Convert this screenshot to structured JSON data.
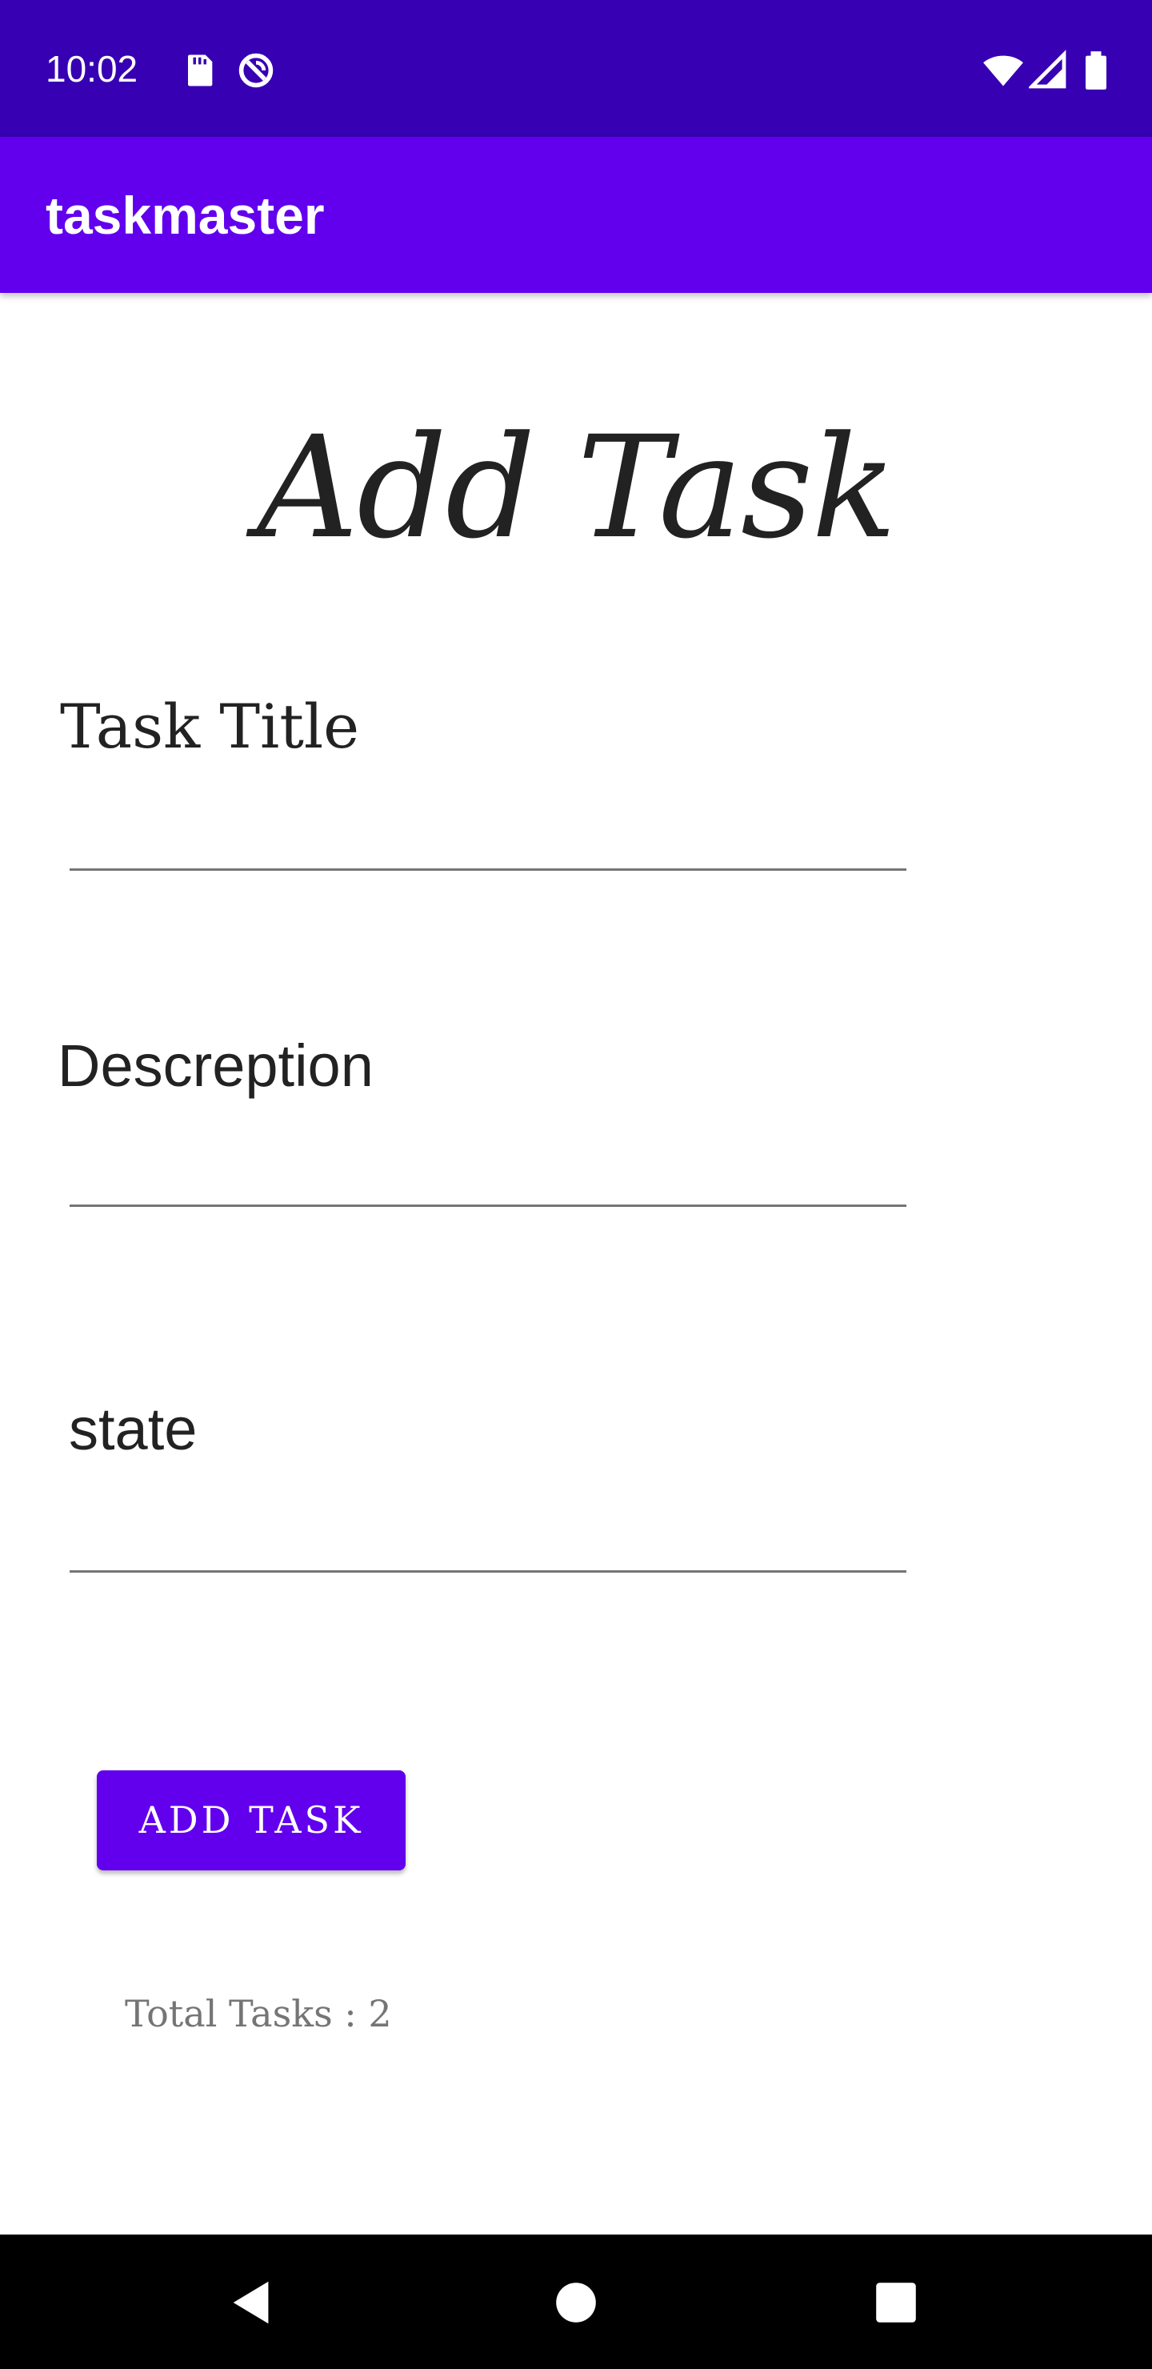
{
  "status_bar": {
    "time": "10:02",
    "left_icons": [
      "sd-card-icon",
      "data-saver-icon"
    ],
    "right_icons": [
      "wifi-icon",
      "signal-icon",
      "battery-icon"
    ],
    "background": "#3700b3"
  },
  "app_bar": {
    "title": "taskmaster",
    "background": "#6200ee"
  },
  "page": {
    "heading": "Add Task"
  },
  "form": {
    "task_title": {
      "label": "Task Title",
      "value": "",
      "placeholder": ""
    },
    "description": {
      "label": "Descreption",
      "value": "",
      "placeholder": ""
    },
    "state": {
      "label": "state",
      "value": "",
      "placeholder": ""
    }
  },
  "actions": {
    "add_task_label": "ADD TASK",
    "accent": "#6200ee"
  },
  "footer": {
    "total_tasks": "Total Tasks : 2"
  },
  "nav_bar": {
    "buttons": [
      "back-icon",
      "home-icon",
      "recents-icon"
    ]
  }
}
